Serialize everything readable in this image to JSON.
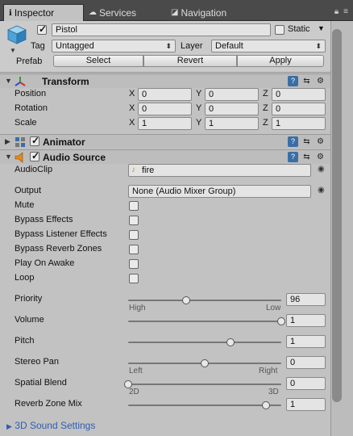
{
  "tabs": [
    {
      "label": "Inspector",
      "icon": "info-icon"
    },
    {
      "label": "Services",
      "icon": "cloud-icon"
    },
    {
      "label": "Navigation",
      "icon": "navigation-icon"
    }
  ],
  "object": {
    "name": "Pistol",
    "active": true,
    "static_label": "Static",
    "static": false,
    "tag_label": "Tag",
    "tag_value": "Untagged",
    "layer_label": "Layer",
    "layer_value": "Default",
    "prefab_label": "Prefab",
    "prefab_buttons": [
      "Select",
      "Revert",
      "Apply"
    ]
  },
  "transform": {
    "title": "Transform",
    "rows": [
      {
        "label": "Position",
        "x": "0",
        "y": "0",
        "z": "0"
      },
      {
        "label": "Rotation",
        "x": "0",
        "y": "0",
        "z": "0"
      },
      {
        "label": "Scale",
        "x": "1",
        "y": "1",
        "z": "1"
      }
    ],
    "axes": [
      "X",
      "Y",
      "Z"
    ]
  },
  "animator": {
    "title": "Animator",
    "enabled": true
  },
  "audio_source": {
    "title": "Audio Source",
    "enabled": true,
    "audioclip_label": "AudioClip",
    "audioclip_value": "fire",
    "output_label": "Output",
    "output_value": "None (Audio Mixer Group)",
    "toggles": [
      {
        "label": "Mute",
        "checked": false
      },
      {
        "label": "Bypass Effects",
        "checked": false
      },
      {
        "label": "Bypass Listener Effects",
        "checked": false
      },
      {
        "label": "Bypass Reverb Zones",
        "checked": false
      },
      {
        "label": "Play On Awake",
        "checked": false
      },
      {
        "label": "Loop",
        "checked": false
      }
    ],
    "priority": {
      "label": "Priority",
      "value": "96",
      "min_label": "High",
      "max_label": "Low",
      "fraction": 0.38
    },
    "volume": {
      "label": "Volume",
      "value": "1",
      "fraction": 1.0
    },
    "pitch": {
      "label": "Pitch",
      "value": "1",
      "fraction": 0.67
    },
    "stereo_pan": {
      "label": "Stereo Pan",
      "value": "0",
      "min_label": "Left",
      "max_label": "Right",
      "fraction": 0.5
    },
    "spatial_blend": {
      "label": "Spatial Blend",
      "value": "0",
      "min_label": "2D",
      "max_label": "3D",
      "fraction": 0.0
    },
    "reverb_zone_mix": {
      "label": "Reverb Zone Mix",
      "value": "1",
      "fraction": 0.9
    },
    "sound_settings_label": "3D Sound Settings"
  }
}
